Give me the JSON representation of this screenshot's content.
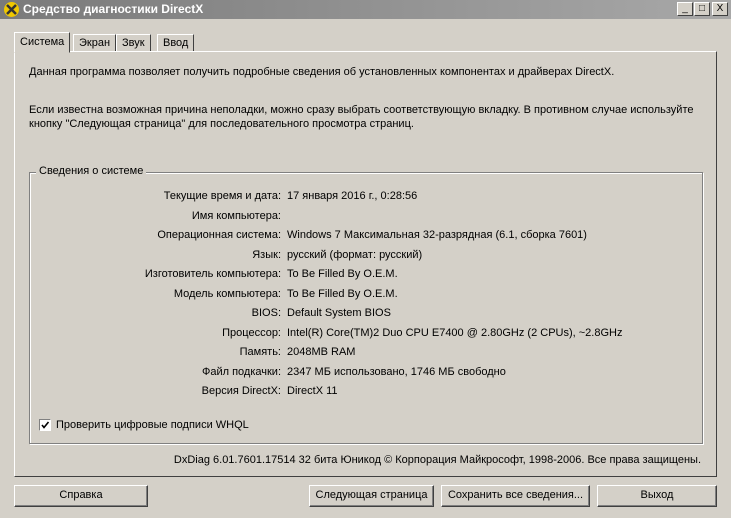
{
  "window": {
    "title": "Средство диагностики DirectX",
    "minimize": "_",
    "maximize": "□",
    "close": "X"
  },
  "tabs": [
    {
      "label": "Система",
      "active": true
    },
    {
      "label": "Экран",
      "active": false
    },
    {
      "label": "Звук",
      "active": false
    },
    {
      "label": "Ввод",
      "active": false
    }
  ],
  "intro": {
    "line1": "Данная программа позволяет получить подробные сведения об установленных компонентах и драйверах DirectX.",
    "line2a": "Если известна возможная причина неполадки, можно сразу выбрать соответствующую вкладку. В противном случае используйте",
    "line2b": "кнопку \"Следующая страница\" для последовательного просмотра страниц."
  },
  "system_info": {
    "group_title": "Сведения о системе",
    "rows": [
      {
        "label": "Текущие время и дата:",
        "value": "17 января 2016 г., 0:28:56"
      },
      {
        "label": "Имя компьютера:",
        "value": ""
      },
      {
        "label": "Операционная система:",
        "value": "Windows 7 Максимальная 32-разрядная (6.1, сборка 7601)"
      },
      {
        "label": "Язык:",
        "value": "русский (формат: русский)"
      },
      {
        "label": "Изготовитель компьютера:",
        "value": "To Be Filled By O.E.M."
      },
      {
        "label": "Модель компьютера:",
        "value": "To Be Filled By O.E.M."
      },
      {
        "label": "BIOS:",
        "value": "Default System BIOS"
      },
      {
        "label": "Процессор:",
        "value": "Intel(R) Core(TM)2 Duo CPU     E7400  @ 2.80GHz (2 CPUs), ~2.8GHz"
      },
      {
        "label": "Память:",
        "value": "2048MB RAM"
      },
      {
        "label": "Файл подкачки:",
        "value": "2347 МБ использовано, 1746 МБ свободно"
      },
      {
        "label": "Версия DirectX:",
        "value": "DirectX 11"
      }
    ],
    "whql_checkbox": {
      "label": "Проверить цифровые подписи WHQL",
      "checked": true
    }
  },
  "footer": {
    "version_text": "DxDiag 6.01.7601.17514 32 бита Юникод  © Корпорация Майкрософт, 1998-2006.  Все права защищены."
  },
  "buttons": {
    "help": "Справка",
    "next": "Следующая страница",
    "save": "Сохранить все сведения...",
    "exit": "Выход"
  }
}
